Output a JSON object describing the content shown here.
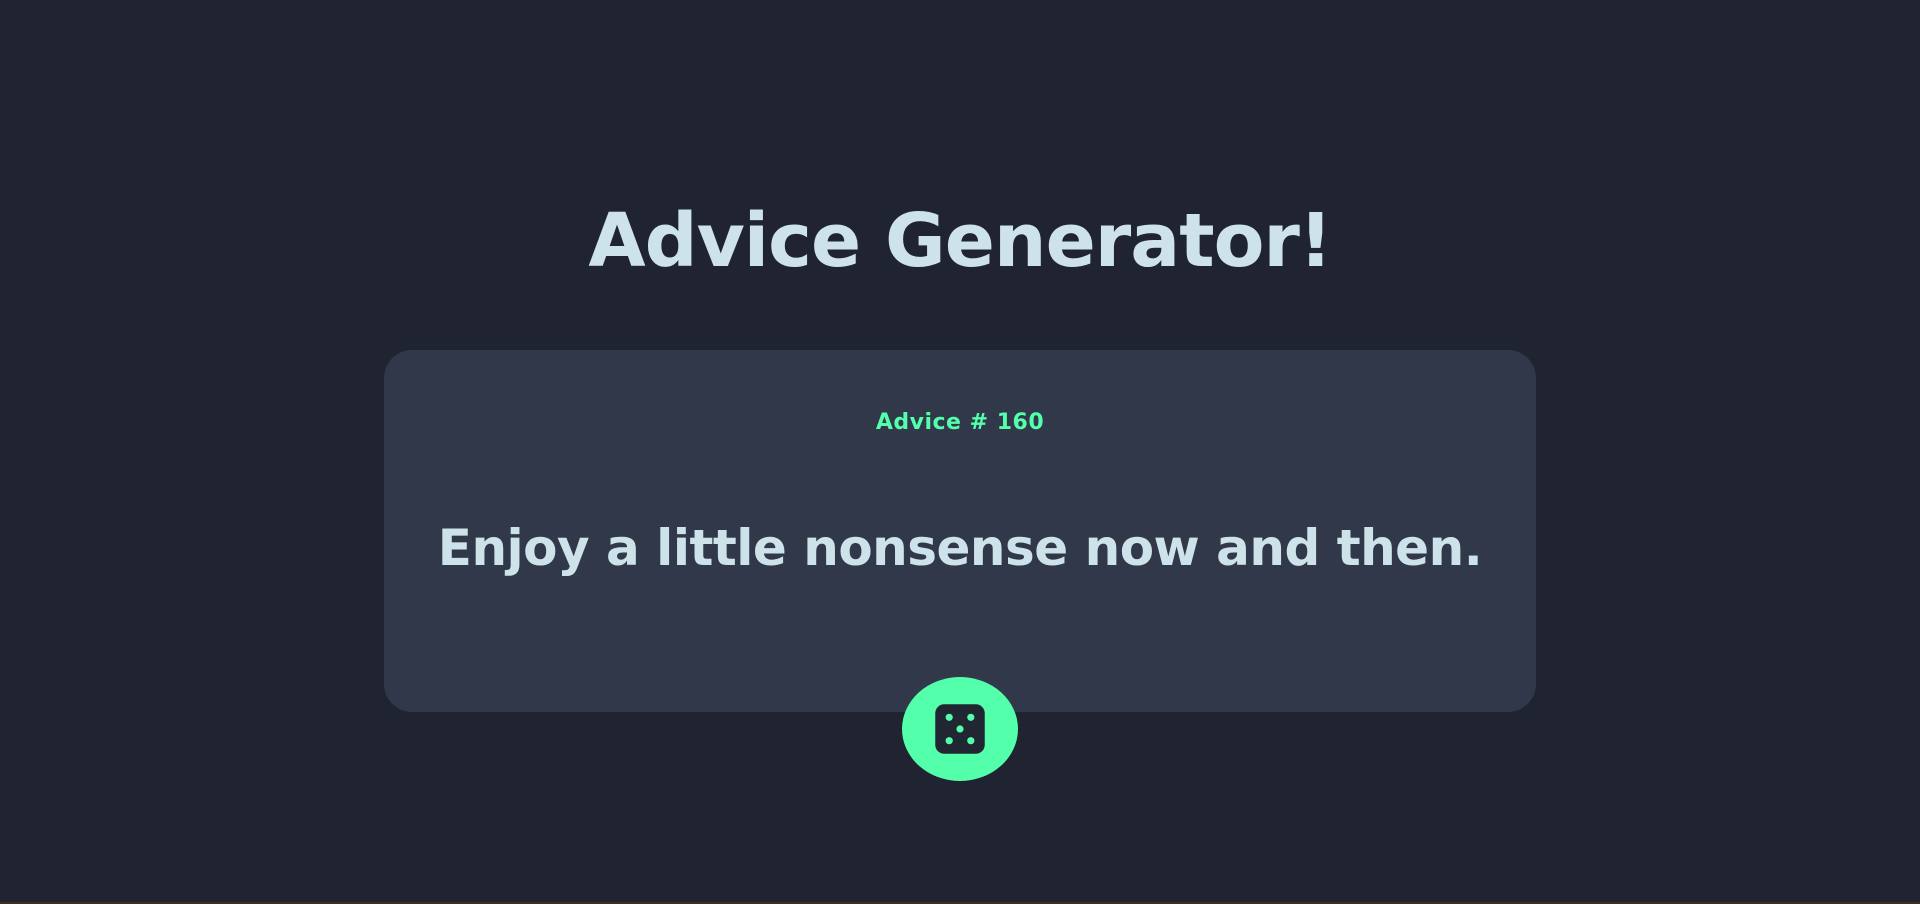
{
  "app": {
    "title": "Advice Generator!"
  },
  "card": {
    "advice_label": "Advice # 160",
    "advice_text": "Enjoy a little nonsense now and then."
  },
  "button": {
    "icon": "dice-icon"
  },
  "colors": {
    "background": "#1f2430",
    "card": "#313849",
    "accent": "#53ffab",
    "text": "#cee3e9",
    "dice": "#202632"
  }
}
